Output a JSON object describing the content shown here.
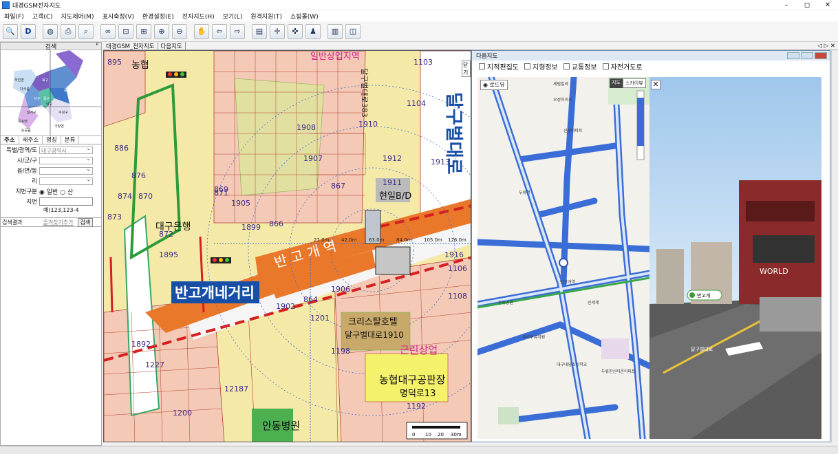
{
  "window": {
    "title": "대경GSM전자지도",
    "min": "–",
    "max": "◻",
    "close": "✕"
  },
  "menu": [
    "파일(F)",
    "고객(C)",
    "지도제어(M)",
    "표시축정(V)",
    "환경설정(E)",
    "전자지도(H)",
    "보기(L)",
    "원격지원(T)",
    "쇼핑몰(W)"
  ],
  "toolbar_icons": [
    "smap-icon",
    "d-logo-icon",
    "globe-icon",
    "print-icon",
    "search-map-icon",
    "binoculars-icon",
    "measure-icon",
    "grid-icon",
    "zoom-in-icon",
    "zoom-out-icon",
    "hand-icon",
    "back-arrow-icon",
    "forward-arrow-icon",
    "layers-icon",
    "cursor-info-icon",
    "cross-cursor-icon",
    "person-view-icon",
    "ruler-icon",
    "split-icon"
  ],
  "left_panel": {
    "header": "검색",
    "pin": "ᴾ",
    "district_labels": [
      "동구",
      "북구",
      "서구",
      "중구",
      "수성구",
      "달서구",
      "남구",
      "달성군",
      "하빈면",
      "다사읍",
      "화원읍",
      "옥포면",
      "논공읍",
      "가창면",
      "현풍면"
    ],
    "tabs": [
      "주소",
      "새주소",
      "명칭",
      "분류"
    ],
    "fields": {
      "sido_label": "특별/광역/도",
      "sido_value": "대구광역시",
      "sigungu_label": "시/군/구",
      "eup_label": "읍/면/동",
      "ri_label": "리",
      "type_label": "지번구분",
      "type_general": "일반",
      "type_mountain": "산",
      "jibun_label": "지번",
      "jibun_hint": "예)123,123-4"
    },
    "result_label": "검색결과",
    "bookmark_label": "즐겨찾기추가",
    "search_button": "검색"
  },
  "map_tabs": [
    "대경GSM_전자지도",
    "다음지도"
  ],
  "map_nav": "◁ ▷ ✕",
  "map": {
    "labels": {
      "intersection": "반고개네거리",
      "station": "반 고 개 역",
      "hotel": "크리스탈호텔",
      "hotel_addr": "달구벌대로1910",
      "building": "현일B/D",
      "bank": "대구은행",
      "nonghyup": "농협",
      "sales": "농협대구공판장",
      "sales_addr": "명덕로13",
      "hospital": "안동병원",
      "commercial": "근린상업",
      "road": "달구벌대로383",
      "top_label": "일반상업지역",
      "road2": "달구벌대로"
    },
    "parcels": [
      "895",
      "867",
      "869",
      "876",
      "886",
      "1905",
      "1899",
      "864",
      "866",
      "1902",
      "1201",
      "1198",
      "1192",
      "1200",
      "1227",
      "12187",
      "1911",
      "1104",
      "1103",
      "1106",
      "1108",
      "1916",
      "1906",
      "1907",
      "1908",
      "1910",
      "1912",
      "1913",
      "872",
      "871",
      "1895",
      "870",
      "873",
      "874",
      "1892"
    ],
    "distances": [
      "21.0m",
      "42.0m",
      "63.0m",
      "84.0m",
      "105.0m",
      "126.0m"
    ],
    "scale_labels": [
      "0",
      "10",
      "20",
      "30m"
    ],
    "close_tab": "닫기"
  },
  "daum_window": {
    "title": "다음지도",
    "checkboxes": [
      "지적편집도",
      "지형정보",
      "교통정보",
      "자전거도로"
    ],
    "roadview_label": "로드뷰",
    "map_type": [
      "지도",
      "스카이뷰"
    ],
    "map_labels": [
      "세림빌라",
      "오성하이츠",
      "신성아파트",
      "두류역",
      "반고개역",
      "두류공원",
      "대구내당초등학교",
      "우리투유치원",
      "신세계",
      "두류한신타운아파트"
    ],
    "sv_badge": "반고개",
    "sv_road": "달구벌대로",
    "sv_store": "WORLD"
  },
  "colors": {
    "accent": "#2a7ae2",
    "road_orange": "#e9782a",
    "zone_yellow": "#f5e9a8",
    "parcel_pink": "#f4c9b5",
    "map_blue": "#3a6ed6"
  }
}
